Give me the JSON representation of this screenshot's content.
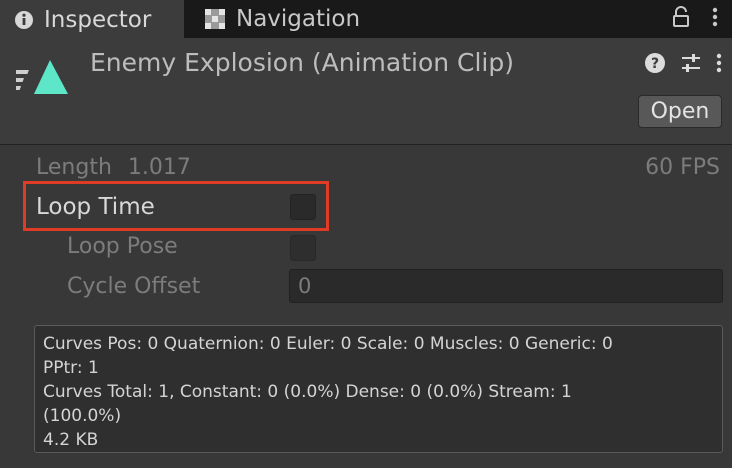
{
  "tabs": {
    "inspector": "Inspector",
    "navigation": "Navigation"
  },
  "header": {
    "title": "Enemy Explosion (Animation Clip)",
    "open_button": "Open"
  },
  "clip": {
    "length_label": "Length",
    "length_value": "1.017",
    "fps": "60 FPS"
  },
  "settings": {
    "loop_time_label": "Loop Time",
    "loop_time_checked": false,
    "loop_pose_label": "Loop Pose",
    "loop_pose_checked": false,
    "cycle_offset_label": "Cycle Offset",
    "cycle_offset_value": "0"
  },
  "info": {
    "line1": "Curves Pos: 0 Quaternion: 0 Euler: 0 Scale: 0 Muscles: 0 Generic: 0",
    "line2": "PPtr: 1",
    "line3": "Curves Total: 1, Constant: 0 (0.0%) Dense: 0 (0.0%) Stream: 1",
    "line4": "(100.0%)",
    "line5": "4.2 KB"
  },
  "colors": {
    "highlight": "#e03c25",
    "clip_icon": "#5ee6c8"
  },
  "icons": [
    "info-icon",
    "navigation-icon",
    "lock-icon",
    "more-vertical-icon",
    "animation-clip-icon",
    "help-icon",
    "preset-sliders-icon"
  ]
}
